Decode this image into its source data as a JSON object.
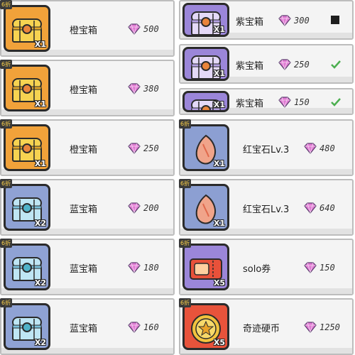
{
  "left_items": [
    {
      "badge": "6折",
      "qty": "X1",
      "name": "橙宝箱",
      "price": "500",
      "tile": "orange",
      "icon": "orange-chest-icon"
    },
    {
      "badge": "6折",
      "qty": "X1",
      "name": "橙宝箱",
      "price": "380",
      "tile": "orange",
      "icon": "orange-chest-icon"
    },
    {
      "badge": "6折",
      "qty": "X1",
      "name": "橙宝箱",
      "price": "250",
      "tile": "orange",
      "icon": "orange-chest-icon"
    },
    {
      "badge": "6折",
      "qty": "X2",
      "name": "蓝宝箱",
      "price": "200",
      "tile": "blue",
      "icon": "blue-chest-icon"
    },
    {
      "badge": "6折",
      "qty": "X2",
      "name": "蓝宝箱",
      "price": "180",
      "tile": "blue",
      "icon": "blue-chest-icon"
    },
    {
      "badge": "6折",
      "qty": "X2",
      "name": "蓝宝箱",
      "price": "160",
      "tile": "blue",
      "icon": "blue-chest-icon"
    }
  ],
  "right_top_items": [
    {
      "badge": "",
      "qty": "X1",
      "name": "紫宝箱",
      "price": "300",
      "tile": "purple",
      "icon": "purple-chest-icon",
      "checkbox": "empty"
    },
    {
      "badge": "",
      "qty": "X1",
      "name": "紫宝箱",
      "price": "250",
      "tile": "purple",
      "icon": "purple-chest-icon",
      "checkbox": "checked"
    },
    {
      "badge": "",
      "qty": "X1",
      "name": "紫宝箱",
      "price": "150",
      "tile": "purple",
      "icon": "purple-chest-icon",
      "checkbox": "checked"
    }
  ],
  "right_items": [
    {
      "badge": "6折",
      "qty": "X1",
      "name": "红宝石Lv.3",
      "price": "480",
      "tile": "periwinkle",
      "icon": "ruby-icon"
    },
    {
      "badge": "6折",
      "qty": "X1",
      "name": "红宝石Lv.3",
      "price": "640",
      "tile": "periwinkle",
      "icon": "ruby-icon"
    },
    {
      "badge": "6折",
      "qty": "X5",
      "name": "solo券",
      "price": "150",
      "tile": "purple",
      "icon": "solo-ticket-icon"
    },
    {
      "badge": "6折",
      "qty": "X5",
      "name": "奇迹硬币",
      "price": "1250",
      "tile": "red",
      "icon": "miracle-coin-icon"
    }
  ],
  "colors": {
    "orange": "#f1a23a",
    "blue": "#8fa2d4",
    "purple": "#9b86d9",
    "periwinkle": "#8c9fd2",
    "red": "#e8533b",
    "gem": "#e07bd3"
  },
  "gem_icon": "diamond-gem-icon"
}
